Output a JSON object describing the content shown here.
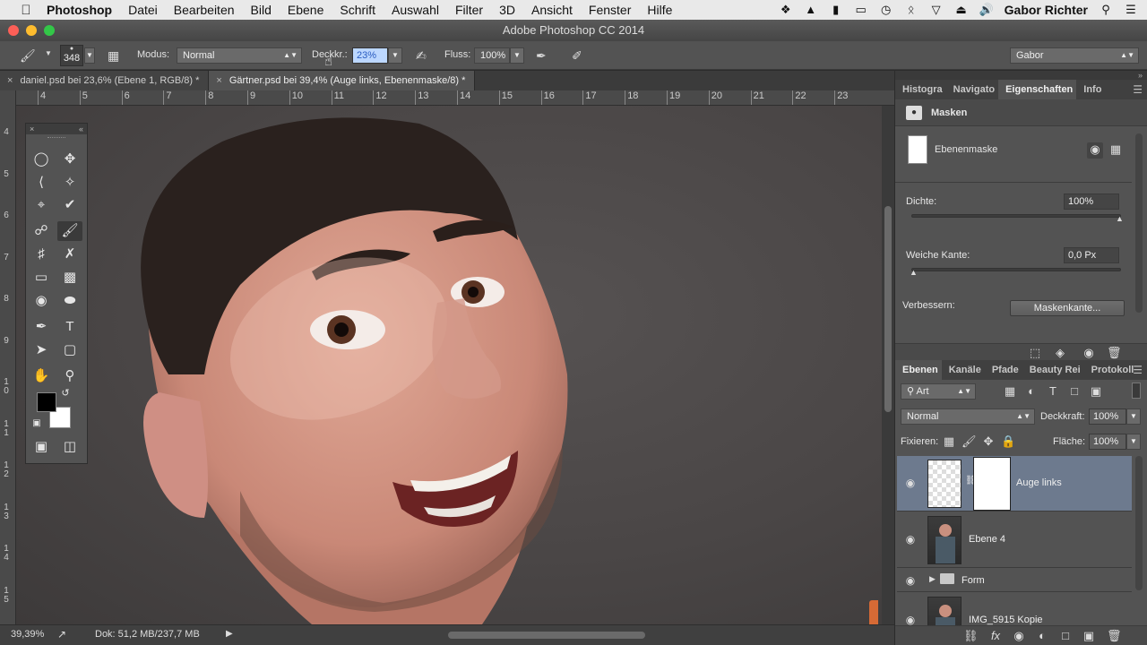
{
  "menubar": {
    "apple": "",
    "items": [
      "Photoshop",
      "Datei",
      "Bearbeiten",
      "Bild",
      "Ebene",
      "Schrift",
      "Auswahl",
      "Filter",
      "3D",
      "Ansicht",
      "Fenster",
      "Hilfe"
    ],
    "user": "Gabor Richter",
    "tray_icons": [
      "wings-icon",
      "hat-icon",
      "battery-plug-icon",
      "airplay-icon",
      "time-machine-icon",
      "bluetooth-icon",
      "wifi-icon",
      "eject-icon",
      "volume-icon"
    ]
  },
  "window": {
    "title": "Adobe Photoshop CC 2014"
  },
  "options": {
    "brush_size": "348",
    "modus_label": "Modus:",
    "modus_value": "Normal",
    "opacity_label": "Deckkr.:",
    "opacity_value": "23%",
    "flow_label": "Fluss:",
    "flow_value": "100%",
    "workspace": "Gabor"
  },
  "tabs": [
    {
      "label": "daniel.psd bei 23,6% (Ebene 1, RGB/8) *",
      "active": false
    },
    {
      "label": "Gärtner.psd bei 39,4% (Auge links, Ebenenmaske/8) *",
      "active": true
    }
  ],
  "ruler_top": [
    "4",
    "5",
    "6",
    "7",
    "8",
    "9",
    "10",
    "11",
    "12",
    "13",
    "14",
    "15",
    "16",
    "17",
    "18",
    "19",
    "20",
    "21",
    "22",
    "23"
  ],
  "ruler_left": [
    "4",
    "5",
    "6",
    "7",
    "8",
    "9",
    "1 0",
    "1 1",
    "1 2",
    "1 3",
    "1 4",
    "1 5"
  ],
  "status": {
    "zoom": "39,39%",
    "doc": "Dok: 51,2 MB/237,7 MB"
  },
  "panels_top": {
    "tabs": [
      "Histogra",
      "Navigato",
      "Eigenschaften",
      "Info"
    ],
    "active": "Eigenschaften",
    "section": "Masken",
    "mask_label": "Ebenenmaske",
    "density_label": "Dichte:",
    "density_value": "100%",
    "density_level": 1.0,
    "feather_label": "Weiche Kante:",
    "feather_value": "0,0 Px",
    "feather_level": 0.0,
    "refine_label": "Verbessern:",
    "refine_button": "Maskenkante..."
  },
  "panels_layers": {
    "tabs": [
      "Ebenen",
      "Kanäle",
      "Pfade",
      "Beauty Rei",
      "Protokoll"
    ],
    "active": "Ebenen",
    "filter": "Art",
    "blend": "Normal",
    "opacity_label": "Deckkraft:",
    "opacity_value": "100%",
    "lock_label": "Fixieren:",
    "fill_label": "Fläche:",
    "fill_value": "100%",
    "layers": [
      {
        "name": "Auge links",
        "active": true
      },
      {
        "name": "Ebene 4",
        "active": false
      },
      {
        "name": "Form",
        "active": false
      },
      {
        "name": "IMG_5915 Kopie",
        "active": false
      }
    ]
  }
}
